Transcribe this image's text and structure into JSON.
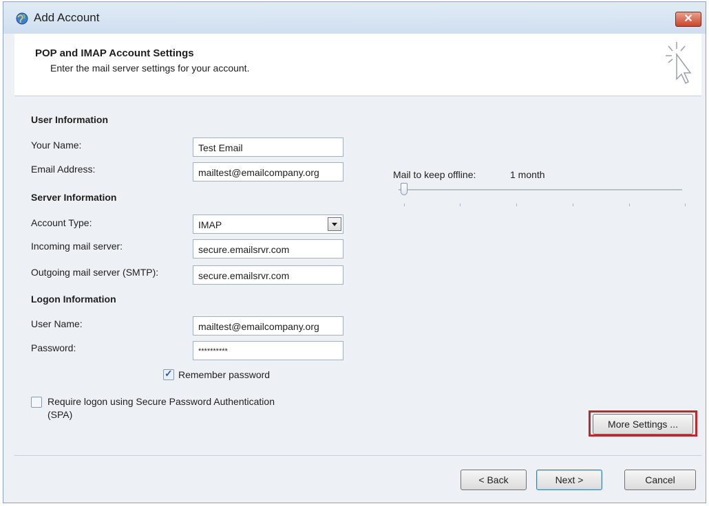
{
  "window": {
    "title": "Add Account",
    "close_label": "✕"
  },
  "header": {
    "title": "POP and IMAP Account Settings",
    "subtitle": "Enter the mail server settings for your account."
  },
  "user_info": {
    "section": "User Information",
    "name_label": "Your Name:",
    "name_value": "Test Email",
    "email_label": "Email Address:",
    "email_value": "mailtest@emailcompany.org"
  },
  "server_info": {
    "section": "Server Information",
    "type_label": "Account Type:",
    "type_value": "IMAP",
    "incoming_label": "Incoming mail server:",
    "incoming_value": "secure.emailsrvr.com",
    "outgoing_label": "Outgoing mail server (SMTP):",
    "outgoing_value": "secure.emailsrvr.com"
  },
  "logon_info": {
    "section": "Logon Information",
    "user_label": "User Name:",
    "user_value": "mailtest@emailcompany.org",
    "password_label": "Password:",
    "password_value": "**********",
    "remember_label": "Remember password",
    "remember_checked": true,
    "spa_line1": "Require logon using Secure Password Authentication",
    "spa_line2": "(SPA)",
    "spa_checked": false
  },
  "offline": {
    "label": "Mail to keep offline:",
    "value": "1 month",
    "slider_position": 0
  },
  "buttons": {
    "more_settings": "More Settings ...",
    "back": "< Back",
    "next": "Next >",
    "cancel": "Cancel"
  },
  "colors": {
    "highlight": "#c0272d",
    "accent": "#2a5caa"
  }
}
